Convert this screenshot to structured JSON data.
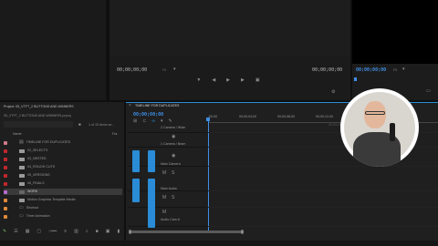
{
  "source_monitor": {
    "timecode_left": "00;00;00;00",
    "fit_label": "Fit",
    "timecode_right": "00;00;00;00"
  },
  "program_monitor": {
    "timecode_left": "00;00;00;00",
    "fit_label": "Fit"
  },
  "project_panel": {
    "title": "Project: 05_VTFT_2 BUTTONS AND WINNERS",
    "subtitle": "05_VTFT_2 BUTTONS AND WINNERS.prproj",
    "items_count": "1 of 15 items se...",
    "col_name": "Name",
    "col_fps": "Fra",
    "items": [
      {
        "label": "TIMELINE FOR DUPLICATES",
        "color": "#d07b8a",
        "kind": "sequence"
      },
      {
        "label": "02_SELECTS",
        "color": "#c3262e",
        "kind": "folder"
      },
      {
        "label": "03_NESTED",
        "color": "#c3262e",
        "kind": "folder"
      },
      {
        "label": "04_ROUGH CUTS",
        "color": "#c3262e",
        "kind": "folder"
      },
      {
        "label": "05_VERSIONS",
        "color": "#c3262e",
        "kind": "folder"
      },
      {
        "label": "06_FINALS",
        "color": "#c3262e",
        "kind": "folder"
      },
      {
        "label": "WORK",
        "color": "#b56ad0",
        "kind": "selected"
      },
      {
        "label": "Motion Graphics Template Media",
        "color": "#e08a3a",
        "kind": "folder"
      },
      {
        "label": "Shortcut",
        "color": "#e08a3a",
        "kind": "file"
      },
      {
        "label": "Timer Animation",
        "color": "#e08a3a",
        "kind": "file"
      }
    ]
  },
  "timeline": {
    "tab_label": "TIMELINE FOR DUPLICATES",
    "timecode": "00;00;00;00",
    "ruler_ticks": [
      ";00;00",
      "00;00;04;00",
      "00;00;08;00",
      "00;00;12;00",
      "00;00;16;00"
    ],
    "tracks": [
      {
        "name": "V2",
        "label": "2 Camera / Wide"
      },
      {
        "name": "V1",
        "label": "1 Camera / Bram"
      },
      {
        "name": "V1",
        "label": "Main Camera"
      },
      {
        "name": "A1",
        "label": "Main Audio"
      },
      {
        "name": "A2",
        "label": ""
      },
      {
        "name": "A3",
        "label": "Audio Cam A"
      }
    ],
    "track_targets": [
      "V1",
      "A1"
    ],
    "track_letters": [
      "M",
      "S"
    ]
  },
  "colors": {
    "accent_blue": "#2a8cd6",
    "timecode_blue": "#3f8fe6",
    "playhead": "#3f8fe6"
  }
}
